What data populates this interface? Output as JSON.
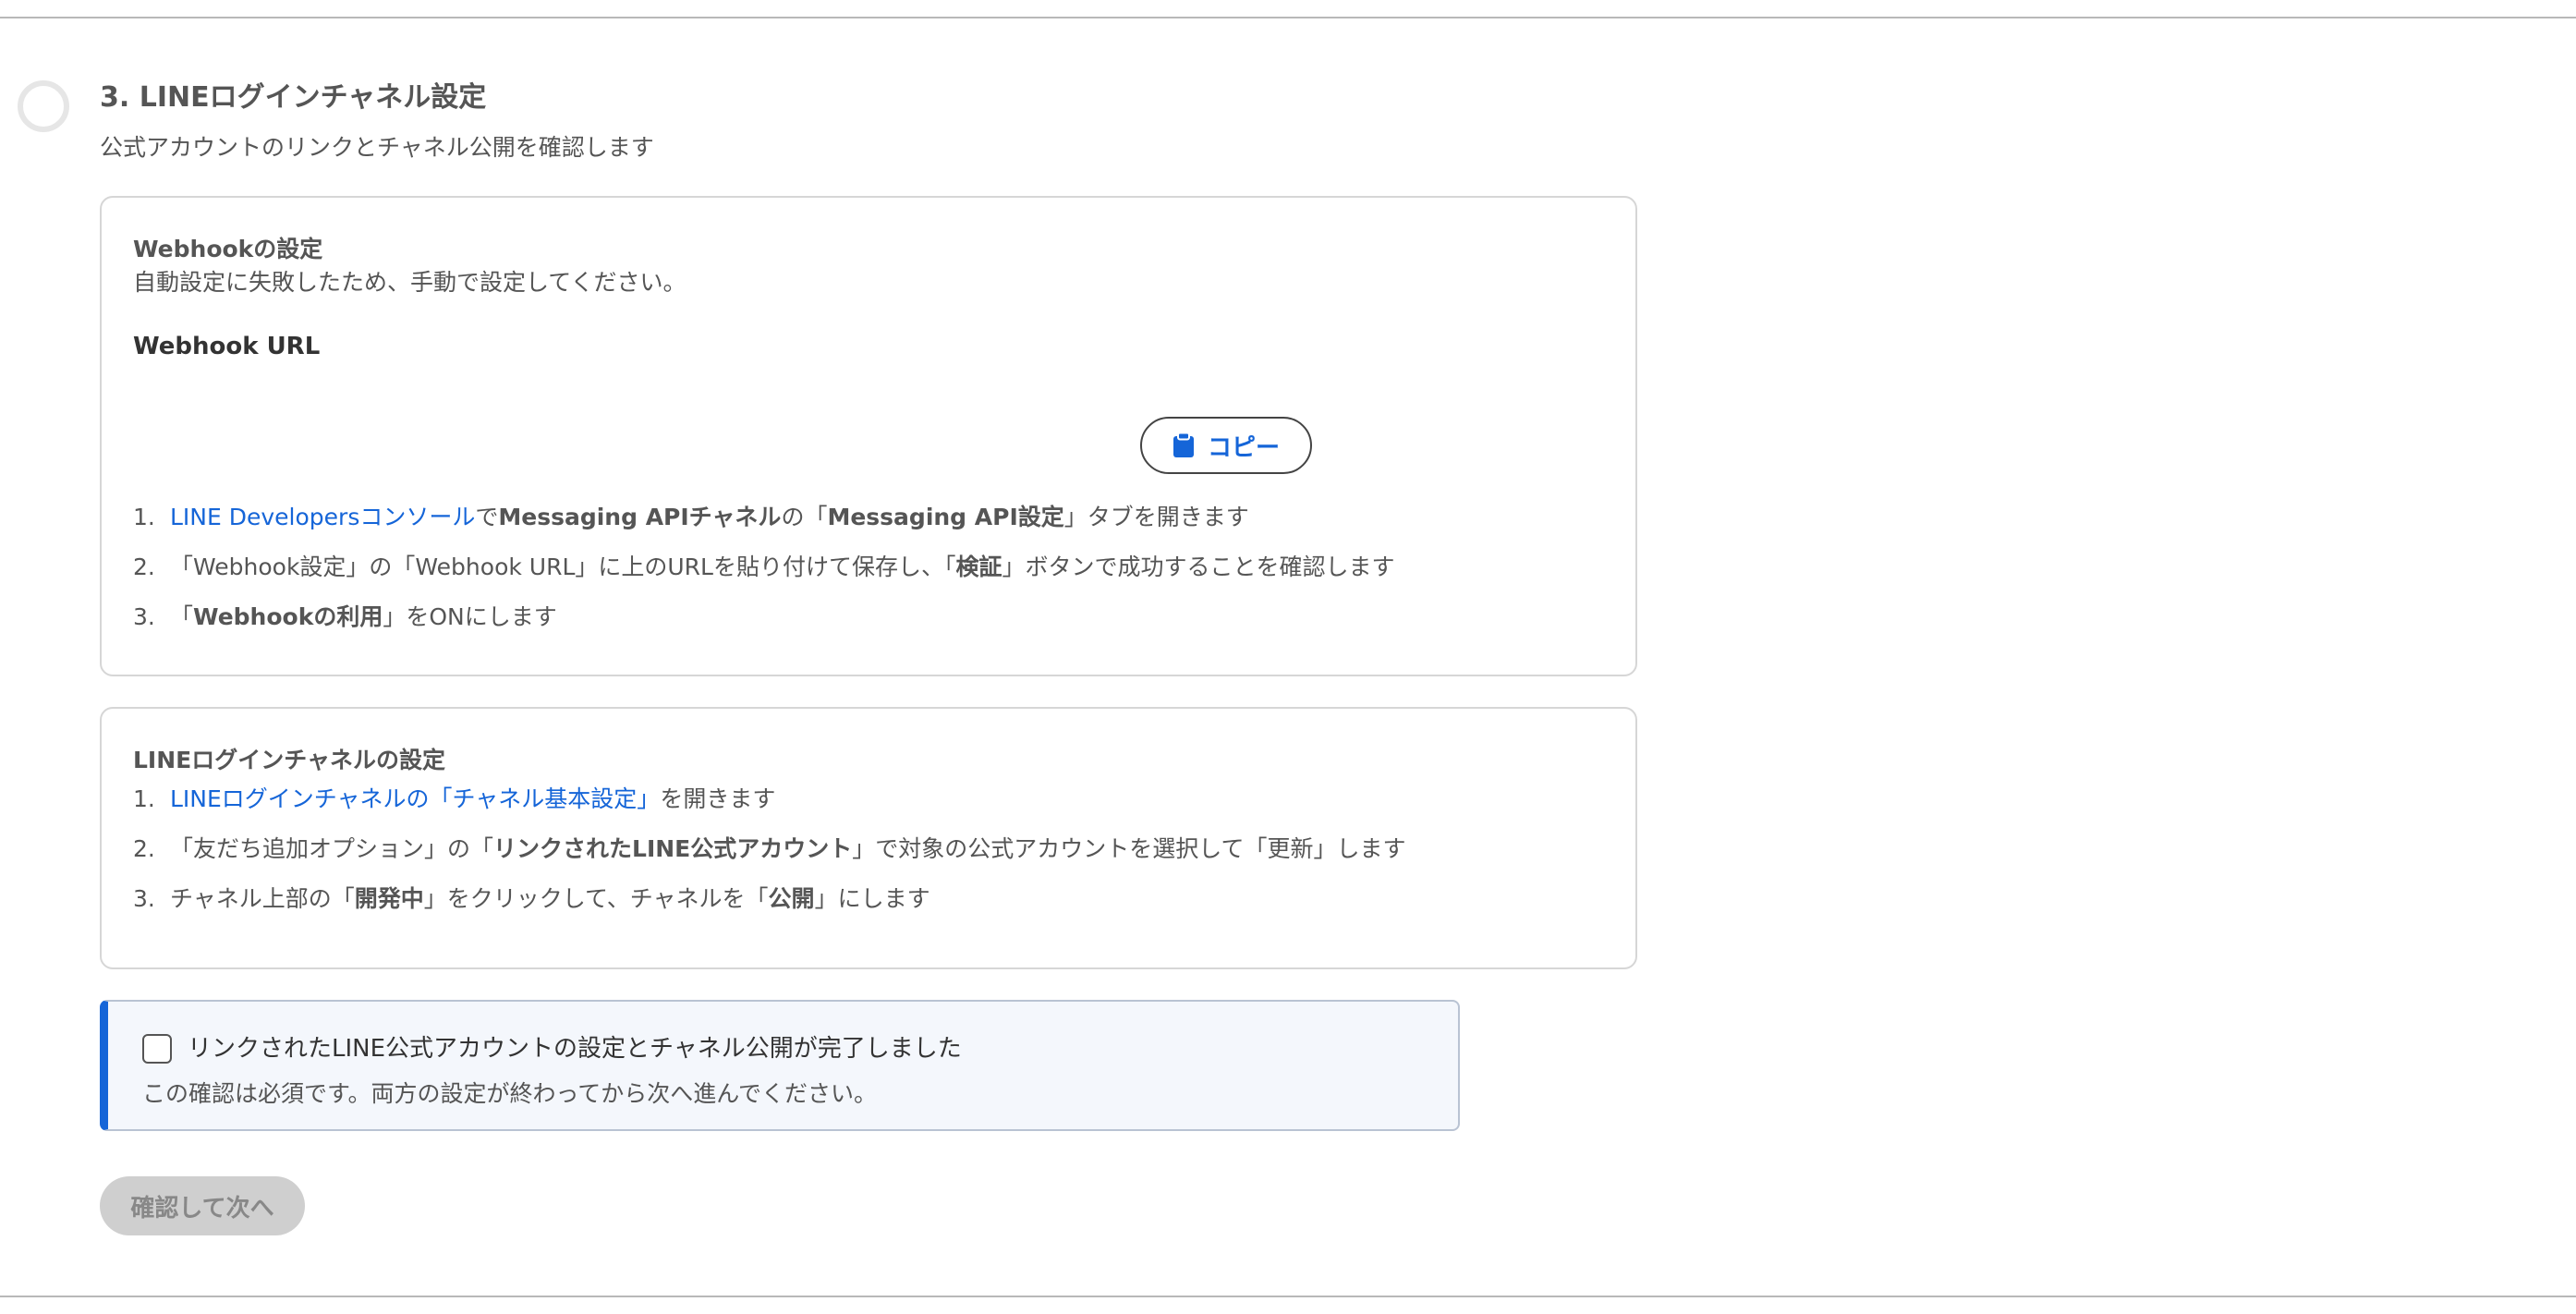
{
  "step": {
    "title": "3. LINEログインチャネル設定",
    "description": "公式アカウントのリンクとチャネル公開を確認します"
  },
  "webhook_card": {
    "heading": "Webhookの設定",
    "error_message": "自動設定に失敗したため、手動で設定してください。",
    "url_label": "Webhook URL",
    "copy_button": {
      "label": "コピー",
      "icon": "clipboard-icon"
    },
    "steps": [
      {
        "number": "1.",
        "link": "LINE Developersコンソール",
        "t1": "で",
        "b1": "Messaging APIチャネル",
        "t2": "の「",
        "b2": "Messaging API設定",
        "t3": "」タブを開きます"
      },
      {
        "number": "2.",
        "t1": "「Webhook設定」の「Webhook URL」に上のURLを貼り付けて保存し、「",
        "b1": "検証",
        "t2": "」ボタンで成功することを確認します"
      },
      {
        "number": "3.",
        "t1": "「",
        "b1": "Webhookの利用",
        "t2": "」をONにします"
      }
    ]
  },
  "login_card": {
    "heading": "LINEログインチャネルの設定",
    "steps": [
      {
        "number": "1.",
        "link": "LINEログインチャネルの「チャネル基本設定」",
        "t1": "を開きます"
      },
      {
        "number": "2.",
        "t1": "「友だち追加オプション」の「",
        "b1": "リンクされたLINE公式アカウント",
        "t2": "」で対象の公式アカウントを選択して「更新」します"
      },
      {
        "number": "3.",
        "t1": "チャネル上部の「",
        "b1": "開発中",
        "t2": "」をクリックして、チャネルを「",
        "b2": "公開",
        "t3": "」にします"
      }
    ]
  },
  "confirmation": {
    "checkbox_label": "リンクされたLINE公式アカウントの設定とチャネル公開が完了しました",
    "checked": false,
    "note": "この確認は必須です。両方の設定が終わってから次へ進んでください。"
  },
  "next_button": {
    "label": "確認して次へ",
    "disabled": true
  },
  "colors": {
    "link": "#1565d8",
    "accent": "#1565d8",
    "confirm_background": "#f4f7fc",
    "disabled_button": "#cfcfcf"
  }
}
